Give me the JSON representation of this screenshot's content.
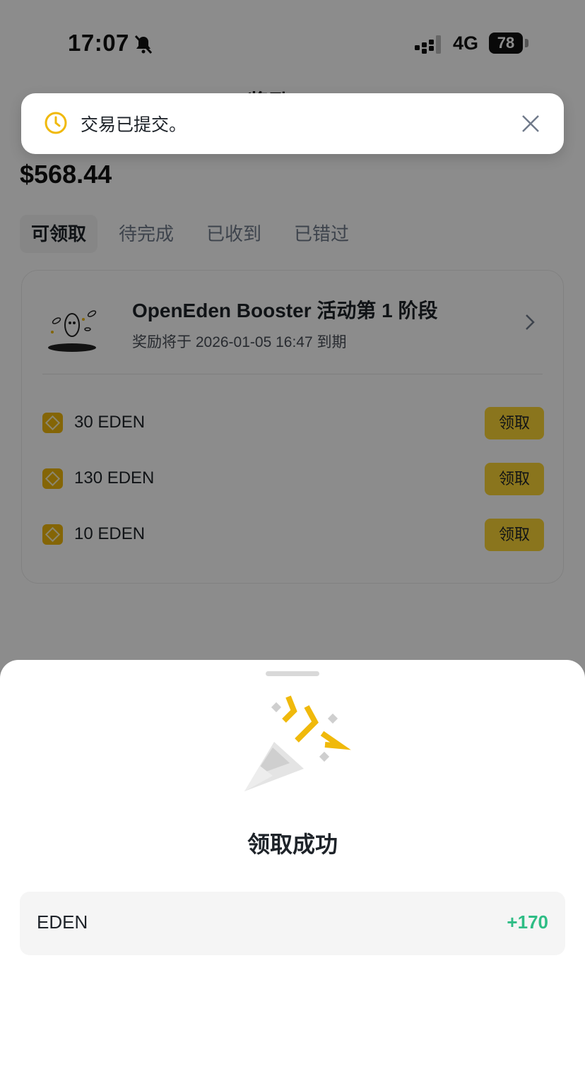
{
  "status_bar": {
    "time": "17:07",
    "network": "4G",
    "battery": "78"
  },
  "header": {
    "title": "奖励"
  },
  "balance": "$568.44",
  "tabs": [
    {
      "label": "可领取"
    },
    {
      "label": "待完成"
    },
    {
      "label": "已收到"
    },
    {
      "label": "已错过"
    }
  ],
  "campaign": {
    "title": "OpenEden Booster 活动第 1 阶段",
    "expiry": "奖励将于 2026-01-05 16:47 到期",
    "rewards": [
      {
        "amount": "30 EDEN",
        "button": "领取"
      },
      {
        "amount": "130 EDEN",
        "button": "领取"
      },
      {
        "amount": "10 EDEN",
        "button": "领取"
      }
    ]
  },
  "toast": {
    "message": "交易已提交。"
  },
  "sheet": {
    "title": "领取成功",
    "result": {
      "token": "EDEN",
      "amount": "+170"
    }
  },
  "colors": {
    "accent": "#fcd535",
    "positive": "#2ebd85",
    "toast_icon": "#f0b90b"
  }
}
